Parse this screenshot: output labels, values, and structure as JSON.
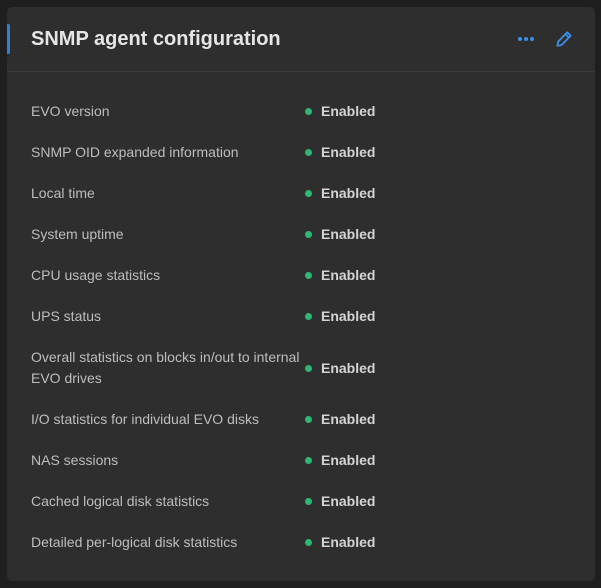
{
  "card": {
    "title": "SNMP agent configuration",
    "accent_color": "#2f7fd6",
    "actions": {
      "more_icon": "more-horizontal-icon",
      "edit_icon": "pencil-icon"
    }
  },
  "status_color": "#2eb872",
  "items": [
    {
      "label": "EVO version",
      "status": "Enabled"
    },
    {
      "label": "SNMP OID expanded information",
      "status": "Enabled"
    },
    {
      "label": "Local time",
      "status": "Enabled"
    },
    {
      "label": "System uptime",
      "status": "Enabled"
    },
    {
      "label": "CPU usage statistics",
      "status": "Enabled"
    },
    {
      "label": "UPS status",
      "status": "Enabled"
    },
    {
      "label": "Overall statistics on blocks in/out to internal EVO drives",
      "status": "Enabled"
    },
    {
      "label": "I/O statistics for individual EVO disks",
      "status": "Enabled"
    },
    {
      "label": "NAS sessions",
      "status": "Enabled"
    },
    {
      "label": "Cached logical disk statistics",
      "status": "Enabled"
    },
    {
      "label": "Detailed per-logical disk statistics",
      "status": "Enabled"
    }
  ]
}
